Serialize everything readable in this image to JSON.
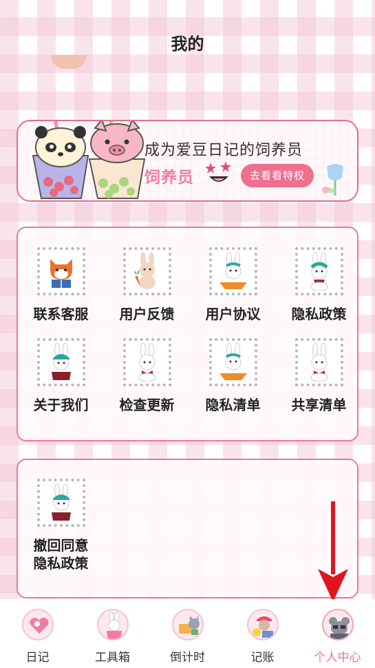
{
  "header": {
    "title": "我的"
  },
  "vip_banner": {
    "title": "成为爱豆日记的饲养员",
    "tag": "饲养员",
    "button_label": "去看看特权"
  },
  "menu_grid": {
    "items": [
      {
        "label": "联系客服",
        "icon": "fox-reading-icon"
      },
      {
        "label": "用户反馈",
        "icon": "bunny-carrot-icon"
      },
      {
        "label": "用户协议",
        "icon": "bunny-orange-icon"
      },
      {
        "label": "隐私政策",
        "icon": "bunny-scarf-icon"
      },
      {
        "label": "关于我们",
        "icon": "bunny-hat-icon"
      },
      {
        "label": "检查更新",
        "icon": "bunny-bow-icon"
      },
      {
        "label": "隐私清单",
        "icon": "bunny-orange-icon"
      },
      {
        "label": "共享清单",
        "icon": "bunny-bow-icon"
      }
    ]
  },
  "extra_grid": {
    "items": [
      {
        "label_line1": "撤回同意",
        "label_line2": "隐私政策",
        "icon": "bunny-hat-icon"
      }
    ]
  },
  "tab_bar": {
    "tabs": [
      {
        "label": "日记",
        "icon": "diary-heart-icon",
        "active": false
      },
      {
        "label": "工具箱",
        "icon": "toolbox-bunny-icon",
        "active": false
      },
      {
        "label": "倒计时",
        "icon": "countdown-cat-icon",
        "active": false
      },
      {
        "label": "记账",
        "icon": "ledger-bear-icon",
        "active": false
      },
      {
        "label": "个人中心",
        "icon": "profile-mouse-icon",
        "active": true
      }
    ]
  },
  "colors": {
    "accent": "#ee6f8e",
    "panel_border": "#ea7a95",
    "active_tab": "#ee6f8e",
    "annotation_arrow": "#e0141e"
  }
}
